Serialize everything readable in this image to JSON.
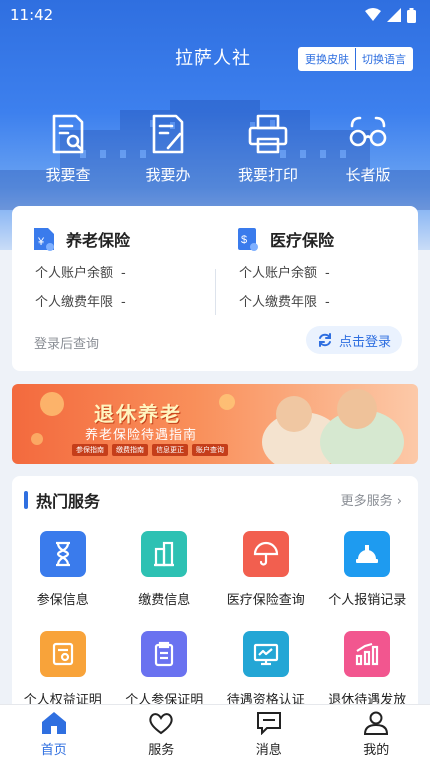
{
  "status_bar": {
    "time": "11:42"
  },
  "header": {
    "title": "拉萨人社",
    "skin_button": "更换皮肤",
    "language_button": "切换语言"
  },
  "quick_actions": [
    {
      "label": "我要查",
      "icon": "document-search-icon"
    },
    {
      "label": "我要办",
      "icon": "document-edit-icon"
    },
    {
      "label": "我要打印",
      "icon": "printer-icon"
    },
    {
      "label": "长者版",
      "icon": "glasses-icon"
    }
  ],
  "insurance": {
    "pension": {
      "title": "养老保险",
      "rows": [
        {
          "label": "个人账户余额",
          "value": "-"
        },
        {
          "label": "个人缴费年限",
          "value": "-"
        }
      ]
    },
    "medical": {
      "title": "医疗保险",
      "rows": [
        {
          "label": "个人账户余额",
          "value": "-"
        },
        {
          "label": "个人缴费年限",
          "value": "-"
        }
      ]
    },
    "hint": "登录后查询",
    "login_button": "点击登录"
  },
  "banner": {
    "title": "退休养老",
    "subtitle": "养老保险待遇指南",
    "chips": [
      "参保指南",
      "缴费指南",
      "信息更正",
      "账户查询"
    ]
  },
  "services": {
    "title": "热门服务",
    "more": "更多服务 ›",
    "items": [
      {
        "label": "参保信息",
        "icon": "hourglass-icon",
        "color": "#3a7bec"
      },
      {
        "label": "缴费信息",
        "icon": "building-icon",
        "color": "#2ec1b3"
      },
      {
        "label": "医疗保险查询",
        "icon": "umbrella-icon",
        "color": "#f25f4f"
      },
      {
        "label": "个人报销记录",
        "icon": "helmet-icon",
        "color": "#1e9bf0"
      },
      {
        "label": "个人权益证明",
        "icon": "certificate-icon",
        "color": "#f8a33a"
      },
      {
        "label": "个人参保证明",
        "icon": "clipboard-icon",
        "color": "#6a72f0"
      },
      {
        "label": "待遇资格认证",
        "icon": "monitor-icon",
        "color": "#23a6d5"
      },
      {
        "label": "退休待遇发放",
        "icon": "bar-chart-icon",
        "color": "#f2568f"
      }
    ]
  },
  "tabbar": [
    {
      "label": "首页",
      "active": true
    },
    {
      "label": "服务",
      "active": false
    },
    {
      "label": "消息",
      "active": false
    },
    {
      "label": "我的",
      "active": false
    }
  ],
  "colors": {
    "primary": "#2f6fe0",
    "background": "#eef2f8"
  }
}
